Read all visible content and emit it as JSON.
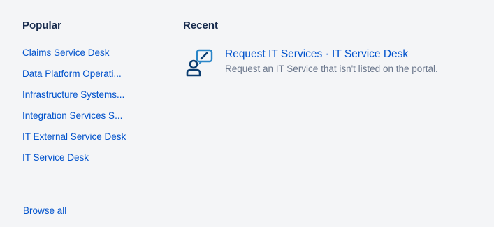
{
  "popular": {
    "heading": "Popular",
    "items": [
      {
        "label": "Claims Service Desk"
      },
      {
        "label": "Data Platform Operati..."
      },
      {
        "label": "Infrastructure Systems..."
      },
      {
        "label": "Integration Services S..."
      },
      {
        "label": "IT External Service Desk"
      },
      {
        "label": "IT Service Desk"
      }
    ],
    "browse_all": "Browse all"
  },
  "recent": {
    "heading": "Recent",
    "items": [
      {
        "title": "Request IT Services · IT Service Desk",
        "description": "Request an IT Service that isn't listed on the portal.",
        "icon": "user-request-icon"
      }
    ]
  },
  "colors": {
    "background": "#f4f5f7",
    "link": "#0052cc",
    "heading": "#172b4d",
    "muted": "#6b778c",
    "icon_dark": "#0b3d70",
    "icon_accent": "#2a86c8"
  }
}
